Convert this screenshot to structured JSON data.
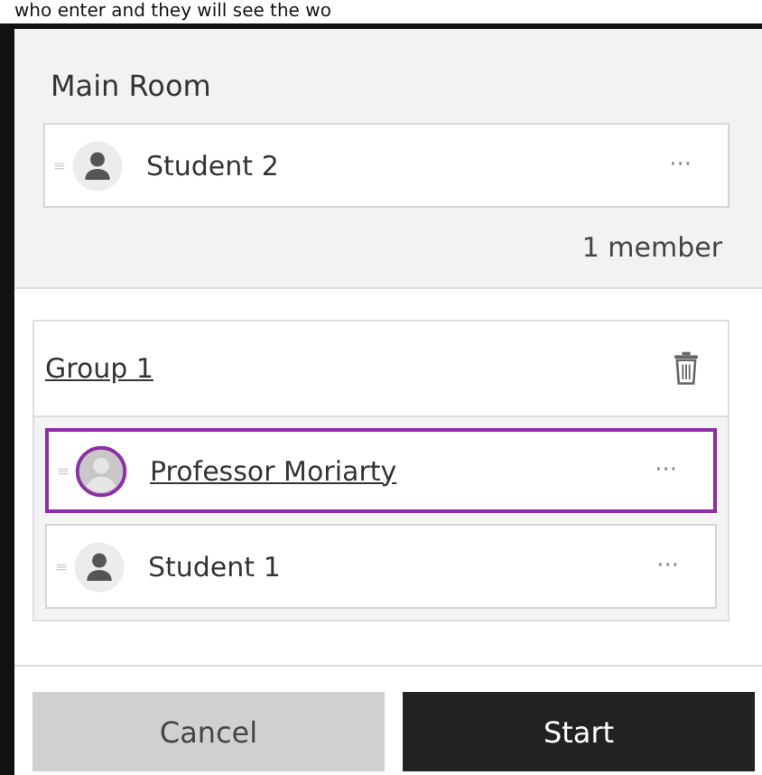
{
  "background_text": "who enter and they will see the wo",
  "main_room": {
    "title": "Main Room",
    "members": [
      {
        "name": "Student 2",
        "kind": "person",
        "selected": false,
        "menu": "···"
      }
    ],
    "count": "1 member"
  },
  "groups": [
    {
      "title": "Group 1",
      "members": [
        {
          "name": "Professor Moriarty",
          "kind": "photo",
          "selected": true,
          "menu": "···"
        },
        {
          "name": "Student 1",
          "kind": "person",
          "selected": false,
          "menu": "···"
        }
      ]
    }
  ],
  "buttons": [
    {
      "label": "Cancel",
      "kind": "secondary"
    },
    {
      "label": "Start",
      "kind": "primary"
    }
  ]
}
